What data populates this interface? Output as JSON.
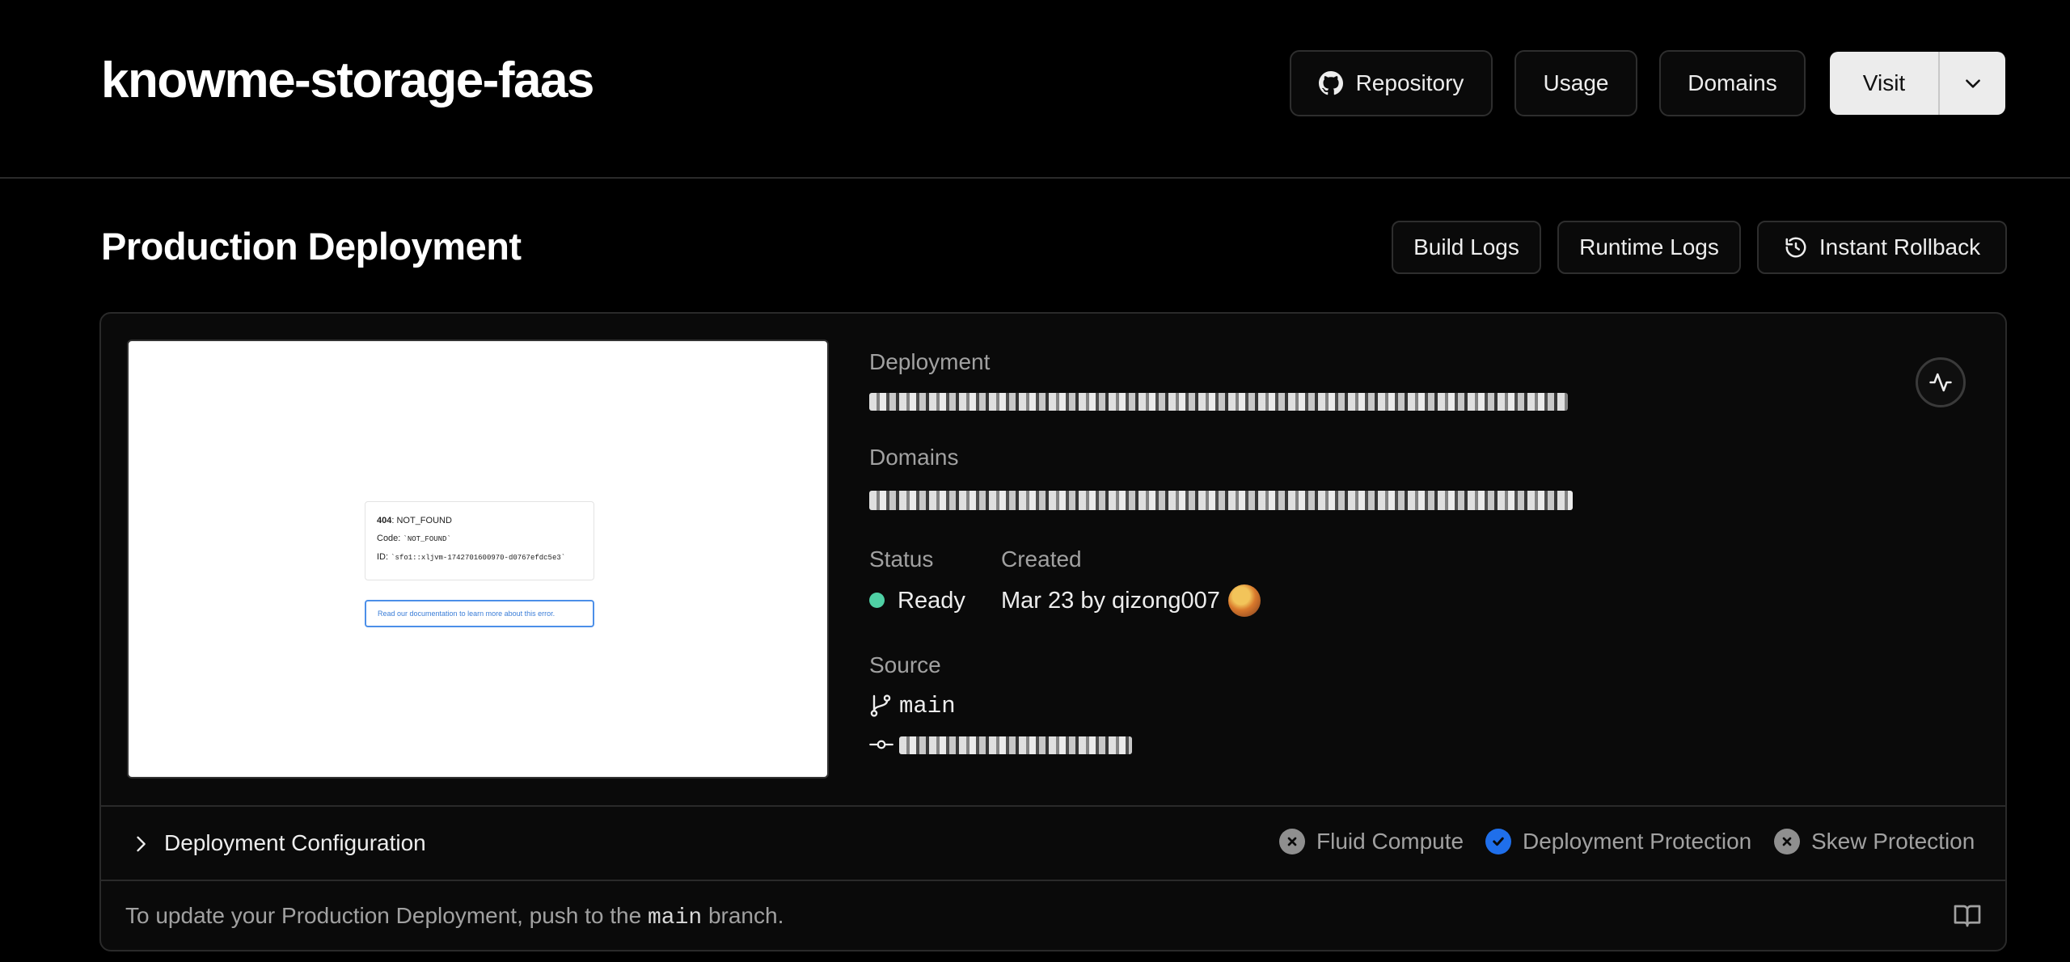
{
  "header": {
    "project_name": "knowme-storage-faas",
    "repository_label": "Repository",
    "usage_label": "Usage",
    "domains_label": "Domains",
    "visit_label": "Visit"
  },
  "section": {
    "title": "Production Deployment",
    "build_logs_label": "Build Logs",
    "runtime_logs_label": "Runtime Logs",
    "rollback_label": "Instant Rollback"
  },
  "preview": {
    "error_code": "404",
    "error_name": ": NOT_FOUND",
    "code_label": "Code: ",
    "code_value": "`NOT_FOUND`",
    "id_label": "ID: ",
    "id_value": "`sfo1::xljvm-1742701600970-d0767efdc5e3`",
    "doc_link": "Read our documentation to learn more about this error."
  },
  "details": {
    "deployment_label": "Deployment",
    "domains_label": "Domains",
    "status_label": "Status",
    "status_value": "Ready",
    "created_label": "Created",
    "created_value": "Mar 23 by qizong007",
    "source_label": "Source",
    "branch": "main"
  },
  "config": {
    "title": "Deployment Configuration",
    "features": [
      {
        "label": "Fluid Compute",
        "enabled": false
      },
      {
        "label": "Deployment Protection",
        "enabled": true
      },
      {
        "label": "Skew Protection",
        "enabled": false
      }
    ]
  },
  "footer": {
    "text_before": "To update your Production Deployment, push to the ",
    "branch": "main",
    "text_after": " branch."
  },
  "colors": {
    "background": "#000000",
    "ready": "#4fd1a5",
    "enabled": "#1f6feb",
    "disabled": "#8f8f8f"
  }
}
